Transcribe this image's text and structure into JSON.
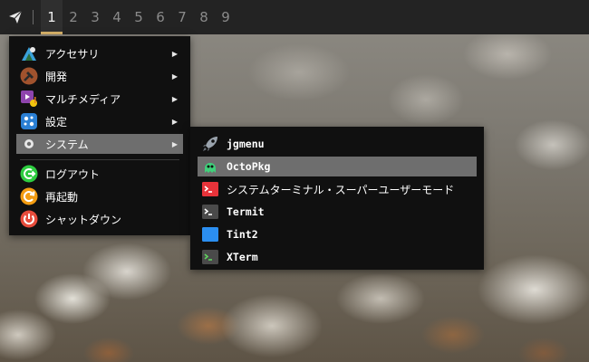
{
  "taskbar": {
    "launcher_icon": "paper-plane-icon",
    "workspaces": [
      "1",
      "2",
      "3",
      "4",
      "5",
      "6",
      "7",
      "8",
      "9"
    ],
    "active_workspace": "1",
    "accent_color": "#d9b36a"
  },
  "main_menu": {
    "items": [
      {
        "label": "アクセサリ",
        "icon": "accessories-icon",
        "submenu": true
      },
      {
        "label": "開発",
        "icon": "development-icon",
        "submenu": true
      },
      {
        "label": "マルチメディア",
        "icon": "multimedia-icon",
        "submenu": true
      },
      {
        "label": "設定",
        "icon": "settings-icon",
        "submenu": true
      },
      {
        "label": "システム",
        "icon": "system-icon",
        "submenu": true,
        "highlighted": true
      }
    ],
    "actions": [
      {
        "label": "ログアウト",
        "icon": "logout-icon"
      },
      {
        "label": "再起動",
        "icon": "reboot-icon"
      },
      {
        "label": "シャットダウン",
        "icon": "shutdown-icon"
      }
    ],
    "submenu_arrow": "▶"
  },
  "system_submenu": {
    "items": [
      {
        "label": "jgmenu",
        "icon": "rocket-icon"
      },
      {
        "label": "OctoPkg",
        "icon": "octopus-icon",
        "highlighted": true
      },
      {
        "label": "システムターミナル・スーパーユーザーモード",
        "icon": "root-terminal-icon"
      },
      {
        "label": "Termit",
        "icon": "terminal-icon"
      },
      {
        "label": "Tint2",
        "icon": "tint2-icon"
      },
      {
        "label": "XTerm",
        "icon": "xterm-icon"
      }
    ]
  }
}
